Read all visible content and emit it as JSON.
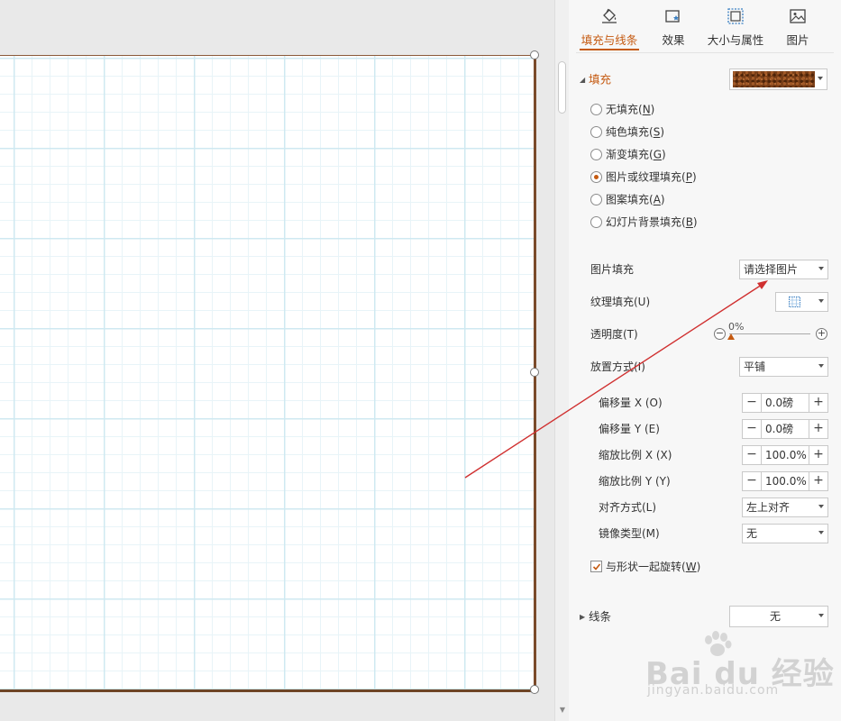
{
  "tabs": [
    {
      "label": "填充与线条",
      "icon": "fill-bucket-icon",
      "active": true
    },
    {
      "label": "效果",
      "icon": "effects-icon",
      "active": false
    },
    {
      "label": "大小与属性",
      "icon": "size-properties-icon",
      "active": false
    },
    {
      "label": "图片",
      "icon": "picture-icon",
      "active": false
    }
  ],
  "fill": {
    "title": "填充",
    "swatch_color": "#7a3f18",
    "options": [
      {
        "label": "无填充(",
        "key": "N",
        "checked": false
      },
      {
        "label": "纯色填充(",
        "key": "S",
        "checked": false
      },
      {
        "label": "渐变填充(",
        "key": "G",
        "checked": false
      },
      {
        "label": "图片或纹理填充(",
        "key": "P",
        "checked": true
      },
      {
        "label": "图案填充(",
        "key": "A",
        "checked": false
      },
      {
        "label": "幻灯片背景填充(",
        "key": "B",
        "checked": false
      }
    ],
    "close_paren": ")",
    "picture_fill": {
      "label": "图片填充",
      "value": "请选择图片"
    },
    "texture_fill": {
      "label": "纹理填充(U)"
    },
    "transparency": {
      "label": "透明度(T)",
      "value": "0%",
      "minus": "−",
      "plus": "+"
    },
    "placement": {
      "label": "放置方式(I)",
      "value": "平铺"
    },
    "offset_x": {
      "label": "偏移量 X (O)",
      "value": "0.0磅"
    },
    "offset_y": {
      "label": "偏移量 Y (E)",
      "value": "0.0磅"
    },
    "scale_x": {
      "label": "缩放比例 X (X)",
      "value": "100.0%"
    },
    "scale_y": {
      "label": "缩放比例 Y (Y)",
      "value": "100.0%"
    },
    "align": {
      "label": "对齐方式(L)",
      "value": "左上对齐"
    },
    "mirror": {
      "label": "镜像类型(M)",
      "value": "无"
    },
    "rotate_with_shape": {
      "label": "与形状一起旋转(",
      "key": "W",
      "close": ")",
      "checked": true
    },
    "spin_minus": "−",
    "spin_plus": "+"
  },
  "line": {
    "title": "线条",
    "value": "无"
  },
  "watermark": {
    "text": "Bai du 经验",
    "url": "jingyan.baidu.com"
  },
  "colors": {
    "accent": "#c55a11",
    "annotation_arrow": "#d03030",
    "slide_frame": "#7a4a2a"
  }
}
